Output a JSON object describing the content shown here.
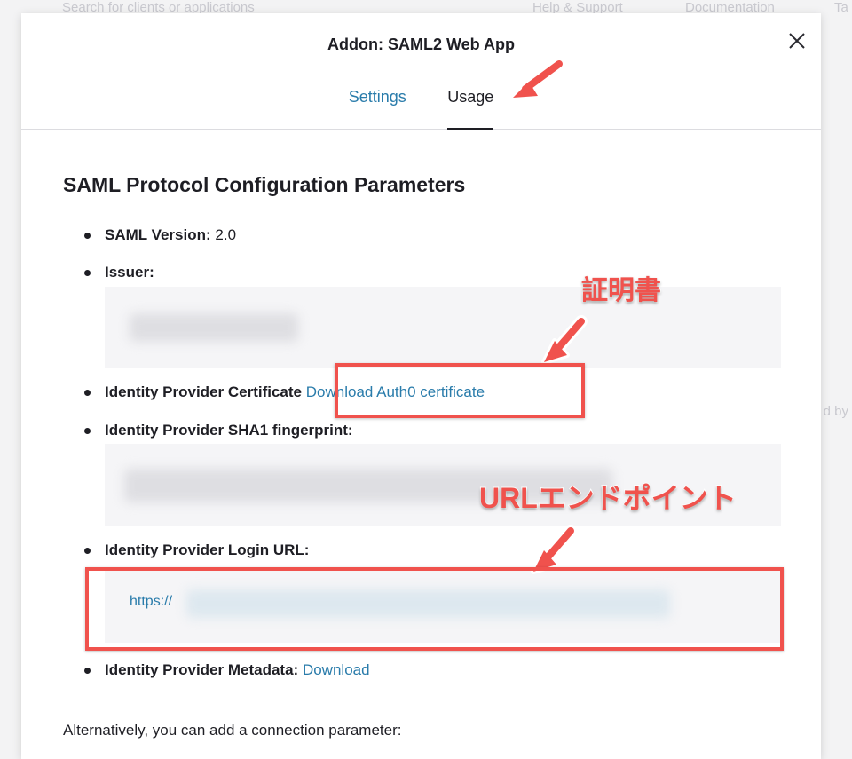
{
  "background": {
    "search_placeholder": "Search for clients or applications",
    "help_link": "Help & Support",
    "docs_link": "Documentation",
    "edge_text": "Ta",
    "side_text": "d by"
  },
  "modal": {
    "title": "Addon: SAML2 Web App",
    "tabs": [
      {
        "label": "Settings",
        "active": false
      },
      {
        "label": "Usage",
        "active": true
      }
    ]
  },
  "content": {
    "heading": "SAML Protocol Configuration Parameters",
    "saml_version_label": "SAML Version:",
    "saml_version_value": "2.0",
    "issuer_label": "Issuer:",
    "certificate_label": "Identity Provider Certificate",
    "certificate_link": "Download Auth0 certificate",
    "fingerprint_label": "Identity Provider SHA1 fingerprint:",
    "login_url_label": "Identity Provider Login URL:",
    "login_url_prefix": "https://",
    "metadata_label": "Identity Provider Metadata:",
    "metadata_link": "Download",
    "alternative_text": "Alternatively, you can add a connection parameter:"
  },
  "annotations": {
    "certificate_label": "証明書",
    "url_label": "URLエンドポイント",
    "color": "#f0524d"
  }
}
